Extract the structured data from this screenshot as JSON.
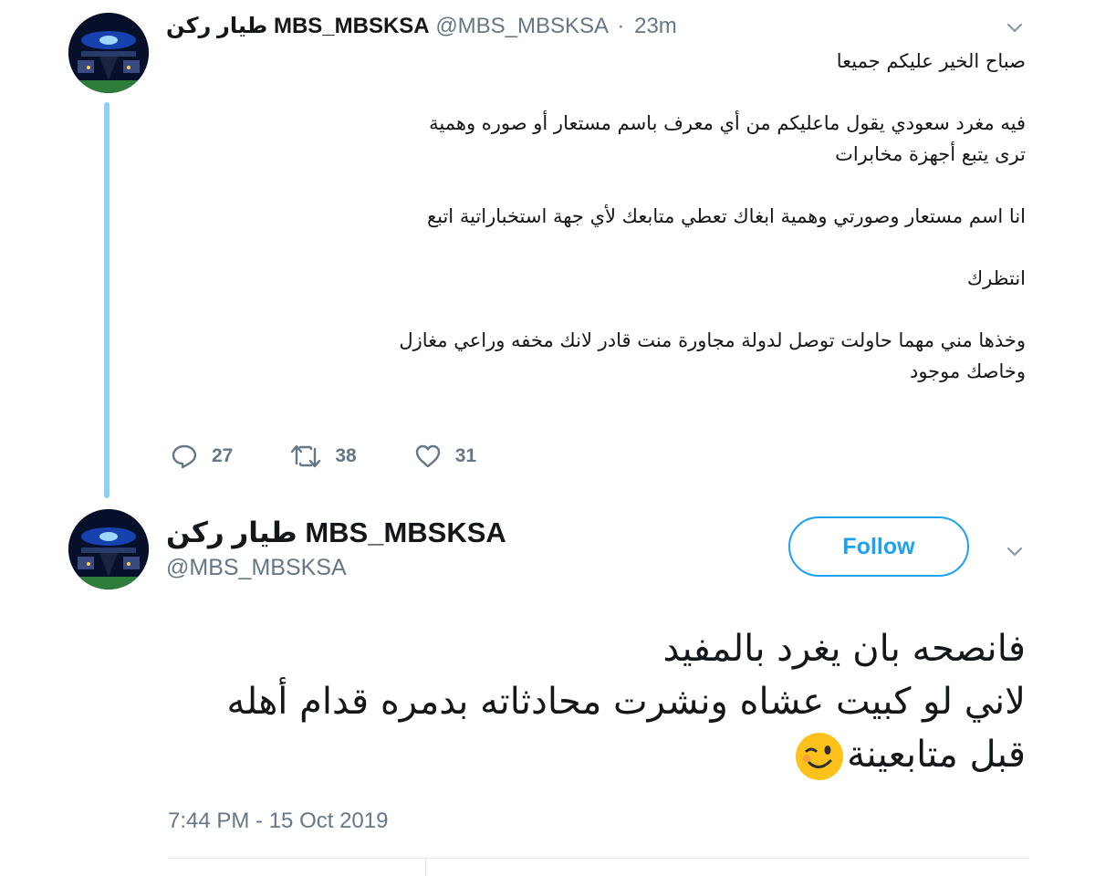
{
  "tweet1": {
    "display_name": "طيار ركن MBS_MBSKSA",
    "handle": "@MBS_MBSKSA",
    "separator": "·",
    "time": "23m",
    "avatar_icon": "avatar-image",
    "paragraphs": [
      {
        "lines": [
          "صباح الخير عليكم جميعا"
        ]
      },
      {
        "lines": [
          "فيه مغرد سعودي يقول ماعليكم من أي معرف باسم مستعار أو صوره وهمية",
          "ترى يتبع أجهزة مخابرات"
        ]
      },
      {
        "lines": [
          "انا اسم مستعار وصورتي وهمية ابغاك تعطي متابعك لأي جهة استخباراتية اتبع"
        ]
      },
      {
        "lines": [
          "انتظرك"
        ]
      },
      {
        "lines": [
          "وخذها مني مهما حاولت توصل لدولة مجاورة منت قادر لانك مخفه وراعي مغازل",
          "وخاصك موجود"
        ]
      }
    ],
    "actions": {
      "reply_icon": "reply-icon",
      "reply_count": "27",
      "retweet_icon": "retweet-icon",
      "retweet_count": "38",
      "like_icon": "heart-icon",
      "like_count": "31"
    }
  },
  "tweet2": {
    "display_name": "طيار ركن MBS_MBSKSA",
    "handle": "@MBS_MBSKSA",
    "follow_label": "Follow",
    "lines": [
      "فانصحه بان يغرد بالمفيد",
      "لاني لو كبيت عشاه ونشرت محادثاته بدمره قدام أهله",
      "قبل متابعينة"
    ],
    "emoji_icon": "winking-face-icon",
    "timestamp": "7:44 PM - 15 Oct 2019"
  },
  "colors": {
    "accent": "#1da1f2",
    "thread_line": "#8ed0f4",
    "secondary_text": "#657786",
    "primary_text": "#14171a"
  }
}
